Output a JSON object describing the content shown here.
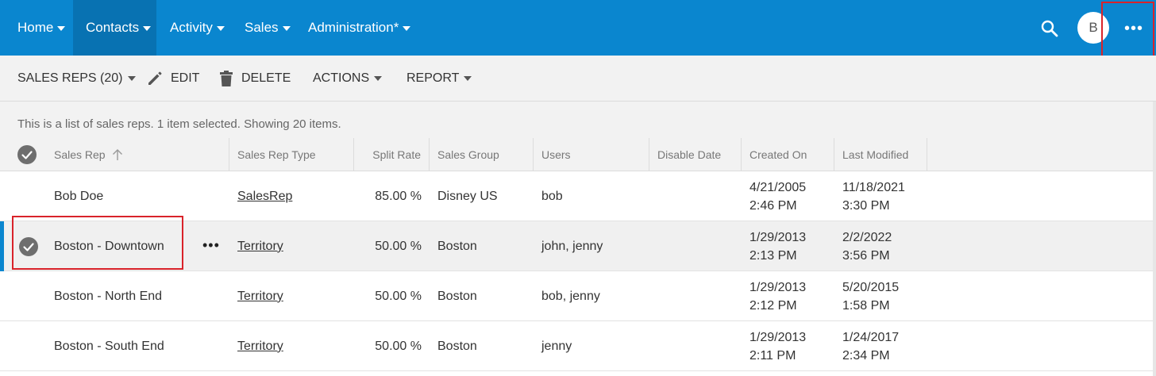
{
  "topnav": {
    "items": [
      {
        "label": "Home"
      },
      {
        "label": "Contacts"
      },
      {
        "label": "Activity"
      },
      {
        "label": "Sales"
      },
      {
        "label": "Administration*"
      }
    ],
    "avatar_initial": "B",
    "more_label": "•••",
    "accent_color": "#0a86cf"
  },
  "toolbar": {
    "view_label": "SALES REPS (20)",
    "edit_label": "EDIT",
    "delete_label": "DELETE",
    "actions_label": "ACTIONS",
    "report_label": "REPORT"
  },
  "info": {
    "text": "This is a list of sales reps. 1 item selected. Showing 20 items."
  },
  "grid": {
    "columns": [
      "Sales Rep",
      "Sales Rep Type",
      "Split Rate",
      "Sales Group",
      "Users",
      "Disable Date",
      "Created On",
      "Last Modified"
    ],
    "rows": [
      {
        "name": "Bob Doe",
        "type": "SalesRep",
        "split": "85.00 %",
        "group": "Disney US",
        "users": "bob",
        "created_date": "4/21/2005",
        "created_time": "2:46 PM",
        "modified_date": "11/18/2021",
        "modified_time": "3:30 PM",
        "selected": false
      },
      {
        "name": "Boston - Downtown",
        "type": "Territory",
        "split": "50.00 %",
        "group": "Boston",
        "users": "john, jenny",
        "created_date": "1/29/2013",
        "created_time": "2:13 PM",
        "modified_date": "2/2/2022",
        "modified_time": "3:56 PM",
        "selected": true
      },
      {
        "name": "Boston - North End",
        "type": "Territory",
        "split": "50.00 %",
        "group": "Boston",
        "users": "bob, jenny",
        "created_date": "1/29/2013",
        "created_time": "2:12 PM",
        "modified_date": "5/20/2015",
        "modified_time": "1:58 PM",
        "selected": false
      },
      {
        "name": "Boston - South End",
        "type": "Territory",
        "split": "50.00 %",
        "group": "Boston",
        "users": "jenny",
        "created_date": "1/29/2013",
        "created_time": "2:11 PM",
        "modified_date": "1/24/2017",
        "modified_time": "2:34 PM",
        "selected": false
      }
    ],
    "row_more_label": "•••"
  }
}
